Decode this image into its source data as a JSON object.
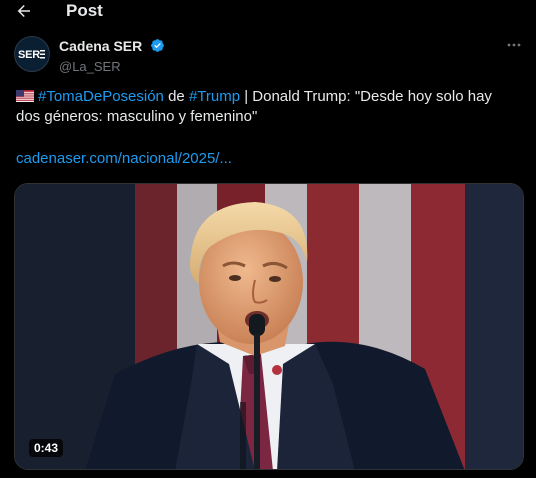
{
  "header": {
    "back_icon": "arrow-left-icon",
    "title": "Post"
  },
  "author": {
    "avatar_text": "SER",
    "display_name": "Cadena SER",
    "handle": "@La_SER",
    "verified_icon": "verified-badge-icon",
    "more_icon": "more-horizontal-icon"
  },
  "tweet": {
    "flag_icon": "us-flag-icon",
    "hashtag1": "#TomaDePosesión",
    "text1": " de ",
    "hashtag2": "#Trump",
    "text2": " | Donald Trump: \"Desde hoy solo hay dos géneros: masculino y femenino\"",
    "link": "cadenaser.com/nacional/2025/..."
  },
  "media": {
    "type": "video",
    "duration": "0:43"
  },
  "colors": {
    "background": "#000000",
    "text": "#e7e9ea",
    "muted": "#71767b",
    "accent": "#1d9bf0"
  }
}
